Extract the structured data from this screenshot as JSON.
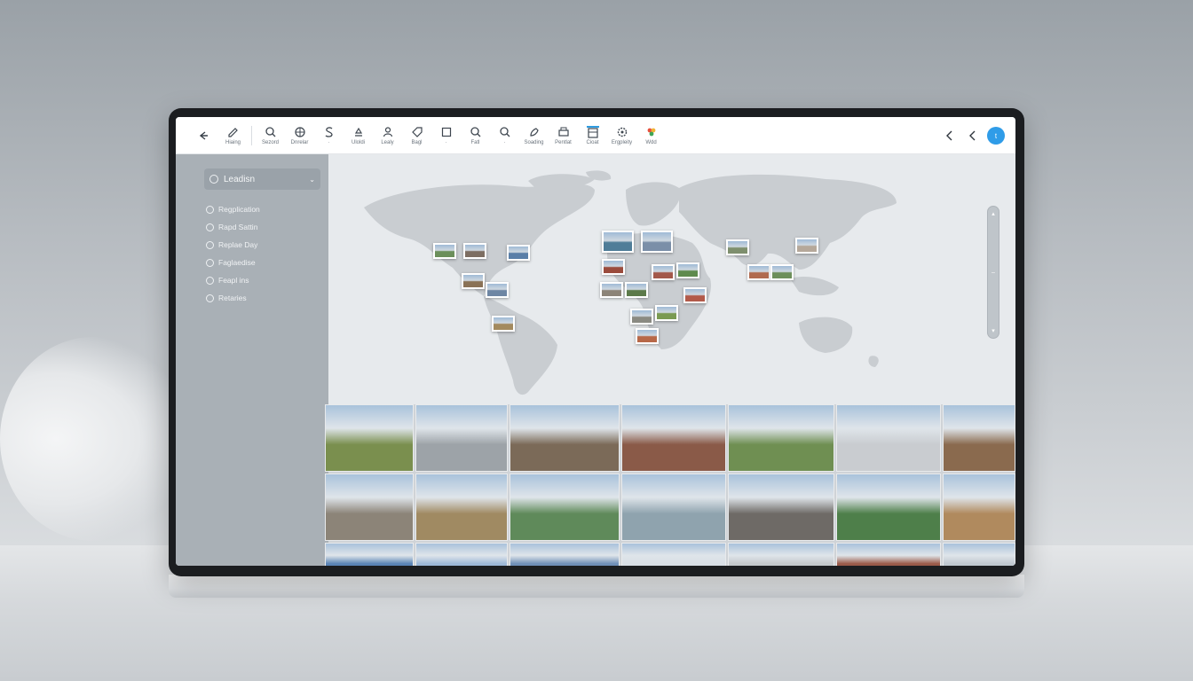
{
  "toolbar": {
    "back_icon": "arrow-left-icon",
    "buttons": [
      {
        "name": "edit",
        "label": "Hiaing"
      },
      {
        "name": "search",
        "label": "Sezord"
      },
      {
        "name": "globe",
        "label": "Dnrelar"
      },
      {
        "name": "strike",
        "label": "·"
      },
      {
        "name": "upload",
        "label": "Uloldi"
      },
      {
        "name": "person",
        "label": "Lealy"
      },
      {
        "name": "tag",
        "label": "Bagl"
      },
      {
        "name": "frame",
        "label": "·"
      },
      {
        "name": "zoom",
        "label": "Fatl"
      },
      {
        "name": "search-2",
        "label": "·"
      },
      {
        "name": "brush",
        "label": "Soading"
      },
      {
        "name": "print",
        "label": "Pentlat"
      },
      {
        "name": "layout",
        "label": "Cioat"
      },
      {
        "name": "settings",
        "label": "Ergpleity"
      },
      {
        "name": "palette",
        "label": "Wdd"
      }
    ],
    "right_chevrons": [
      "chevron-left-icon",
      "chevron-left-icon"
    ],
    "avatar_text": "t"
  },
  "sidebar": {
    "section_title": "Leadisn",
    "items": [
      {
        "label": "Regplication"
      },
      {
        "label": "Rapd Sattin"
      },
      {
        "label": "Replae Day"
      },
      {
        "label": "Faglaedise"
      },
      {
        "label": "Feapl ins"
      },
      {
        "label": "Retaries"
      }
    ]
  },
  "map": {
    "scroll_up": "▴",
    "scroll_mid": "–",
    "scroll_down": "▾",
    "pins": [
      {
        "region": "north-america",
        "color": "#6b8f5a"
      },
      {
        "region": "north-america",
        "color": "#7d6e62"
      },
      {
        "region": "north-america",
        "color": "#5a7fa8"
      },
      {
        "region": "north-america",
        "color": "#8a7256"
      },
      {
        "region": "central-america",
        "color": "#6e86a3"
      },
      {
        "region": "south-america",
        "color": "#a38a5e"
      },
      {
        "region": "europe",
        "color": "#4f7d98"
      },
      {
        "region": "europe",
        "color": "#7b8fa8"
      },
      {
        "region": "europe",
        "color": "#9a4b3c"
      },
      {
        "region": "europe",
        "color": "#a3584a"
      },
      {
        "region": "europe",
        "color": "#5f8b4e"
      },
      {
        "region": "africa",
        "color": "#8c8478"
      },
      {
        "region": "africa",
        "color": "#5c7a4a"
      },
      {
        "region": "africa",
        "color": "#b25a4a"
      },
      {
        "region": "africa",
        "color": "#8a8a82"
      },
      {
        "region": "africa",
        "color": "#7a9a52"
      },
      {
        "region": "africa",
        "color": "#b76848"
      },
      {
        "region": "asia",
        "color": "#7e8f6e"
      },
      {
        "region": "asia",
        "color": "#b06a4e"
      },
      {
        "region": "asia",
        "color": "#6d8f5a"
      },
      {
        "region": "asia",
        "color": "#b5a89a"
      }
    ]
  },
  "gallery": {
    "rows": [
      [
        "#7a8f4e",
        "#9da3a8",
        "#7b6a58",
        "#8a5a48",
        "#6f8f52",
        "#c9ccd0",
        "#8a6a4e"
      ],
      [
        "#8c8478",
        "#a08a62",
        "#5f8a5a",
        "#8fa3ae",
        "#6e6a66",
        "#4e7f4a",
        "#b08a5e"
      ],
      [
        "#5a84b6",
        "#9db8d8",
        "#6f8fb8",
        "#d8dfe6",
        "#c4c8cc",
        "#9a5a4a",
        "#c0c8d0"
      ]
    ]
  }
}
